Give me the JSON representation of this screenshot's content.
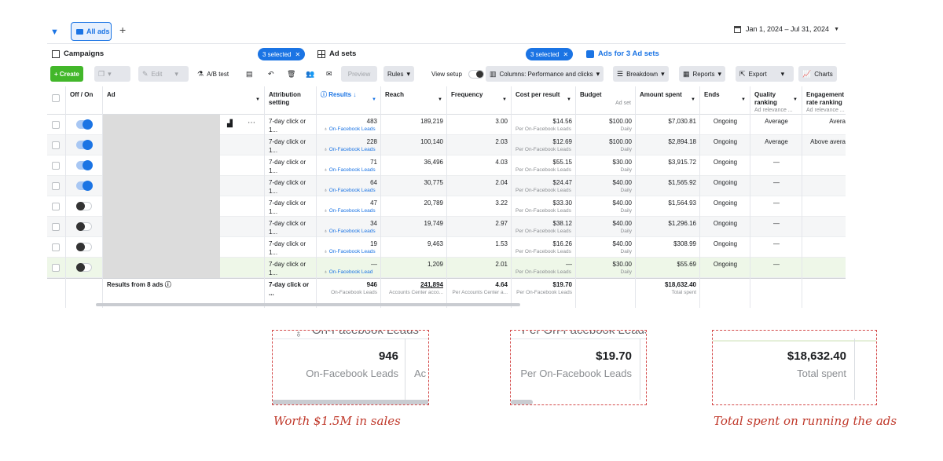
{
  "tabs": {
    "all_ads": "All ads",
    "plus": "+"
  },
  "date_range": "Jan 1, 2024 – Jul 31, 2024",
  "levels": {
    "campaigns": "Campaigns",
    "selected_1": "3 selected",
    "ad_sets": "Ad sets",
    "selected_2": "3 selected",
    "ads_for": "Ads for 3 Ad sets"
  },
  "toolbar": {
    "create": "+ Create",
    "edit": "Edit",
    "ab_test": "A/B test",
    "preview": "Preview",
    "rules": "Rules",
    "view_setup": "View setup",
    "columns": "Columns: Performance and clicks",
    "breakdown": "Breakdown",
    "reports": "Reports",
    "export": "Export",
    "charts": "Charts"
  },
  "headers": {
    "offon": "Off / On",
    "ad": "Ad",
    "attribution": "Attribution setting",
    "results": "Results ↓",
    "reach": "Reach",
    "frequency": "Frequency",
    "cpr": "Cost per result",
    "budget": "Budget",
    "budget_sub": "Ad set",
    "amount": "Amount spent",
    "ends": "Ends",
    "quality": "Quality ranking",
    "quality_sub": "Ad relevance ...",
    "engagement": "Engagement rate ranking",
    "engagement_sub": "Ad relevance ..."
  },
  "rows": [
    {
      "on": true,
      "attr": "7-day click or 1...",
      "results": "483",
      "result_type": "On-Facebook Leads",
      "reach": "189,219",
      "freq": "3.00",
      "cpr": "$14.56",
      "cpr_sub": "Per On-Facebook Leads",
      "budget": "$100.00",
      "budget_sub": "Daily",
      "amount": "$7,030.81",
      "ends": "Ongoing",
      "quality": "Average",
      "engagement": "Avera"
    },
    {
      "on": true,
      "attr": "7-day click or 1...",
      "results": "228",
      "result_type": "On-Facebook Leads",
      "reach": "100,140",
      "freq": "2.03",
      "cpr": "$12.69",
      "cpr_sub": "Per On-Facebook Leads",
      "budget": "$100.00",
      "budget_sub": "Daily",
      "amount": "$2,894.18",
      "ends": "Ongoing",
      "quality": "Average",
      "engagement": "Above avera"
    },
    {
      "on": true,
      "attr": "7-day click or 1...",
      "results": "71",
      "result_type": "On-Facebook Leads",
      "reach": "36,496",
      "freq": "4.03",
      "cpr": "$55.15",
      "cpr_sub": "Per On-Facebook Leads",
      "budget": "$30.00",
      "budget_sub": "Daily",
      "amount": "$3,915.72",
      "ends": "Ongoing",
      "quality": "—",
      "engagement": ""
    },
    {
      "on": true,
      "attr": "7-day click or 1...",
      "results": "64",
      "result_type": "On-Facebook Leads",
      "reach": "30,775",
      "freq": "2.04",
      "cpr": "$24.47",
      "cpr_sub": "Per On-Facebook Leads",
      "budget": "$40.00",
      "budget_sub": "Daily",
      "amount": "$1,565.92",
      "ends": "Ongoing",
      "quality": "—",
      "engagement": ""
    },
    {
      "on": false,
      "attr": "7-day click or 1...",
      "results": "47",
      "result_type": "On-Facebook Leads",
      "reach": "20,789",
      "freq": "3.22",
      "cpr": "$33.30",
      "cpr_sub": "Per On-Facebook Leads",
      "budget": "$40.00",
      "budget_sub": "Daily",
      "amount": "$1,564.93",
      "ends": "Ongoing",
      "quality": "—",
      "engagement": ""
    },
    {
      "on": false,
      "attr": "7-day click or 1...",
      "results": "34",
      "result_type": "On-Facebook Leads",
      "reach": "19,749",
      "freq": "2.97",
      "cpr": "$38.12",
      "cpr_sub": "Per On-Facebook Leads",
      "budget": "$40.00",
      "budget_sub": "Daily",
      "amount": "$1,296.16",
      "ends": "Ongoing",
      "quality": "—",
      "engagement": ""
    },
    {
      "on": false,
      "attr": "7-day click or 1...",
      "results": "19",
      "result_type": "On-Facebook Leads",
      "reach": "9,463",
      "freq": "1.53",
      "cpr": "$16.26",
      "cpr_sub": "Per On-Facebook Leads",
      "budget": "$40.00",
      "budget_sub": "Daily",
      "amount": "$308.99",
      "ends": "Ongoing",
      "quality": "—",
      "engagement": ""
    },
    {
      "on": false,
      "attr": "7-day click or 1...",
      "results": "—",
      "result_type": "On-Facebook Lead",
      "reach": "1,209",
      "freq": "2.01",
      "cpr": "—",
      "cpr_sub": "Per On-Facebook Leads",
      "budget": "$30.00",
      "budget_sub": "Daily",
      "amount": "$55.69",
      "ends": "Ongoing",
      "quality": "—",
      "engagement": ""
    }
  ],
  "summary": {
    "label": "Results from 8 ads",
    "attr": "7-day click or ...",
    "results": "946",
    "results_sub": "On-Facebook Leads",
    "reach": "241,894",
    "reach_sub": "Accounts Center acco...",
    "freq": "4.64",
    "freq_sub": "Per Accounts Center a...",
    "cpr": "$19.70",
    "cpr_sub": "Per On-Facebook Leads",
    "amount": "$18,632.40",
    "amount_sub": "Total spent"
  },
  "zoom": {
    "box1_clip": "On-Facebook Leads",
    "box1_big": "946",
    "box1_small": "On-Facebook Leads",
    "box1_edge": "Ac",
    "box2_clip": "Per On-Facebook Leads",
    "box2_big": "$19.70",
    "box2_small": "Per On-Facebook Leads",
    "box3_big": "$18,632.40",
    "box3_small": "Total spent"
  },
  "notes": {
    "note1": "Worth $1.5M in sales",
    "note2": "Total spent on running the ads"
  },
  "colors": {
    "accent": "#1b74e4",
    "create": "#42b72a",
    "annotation": "#c0392b"
  }
}
